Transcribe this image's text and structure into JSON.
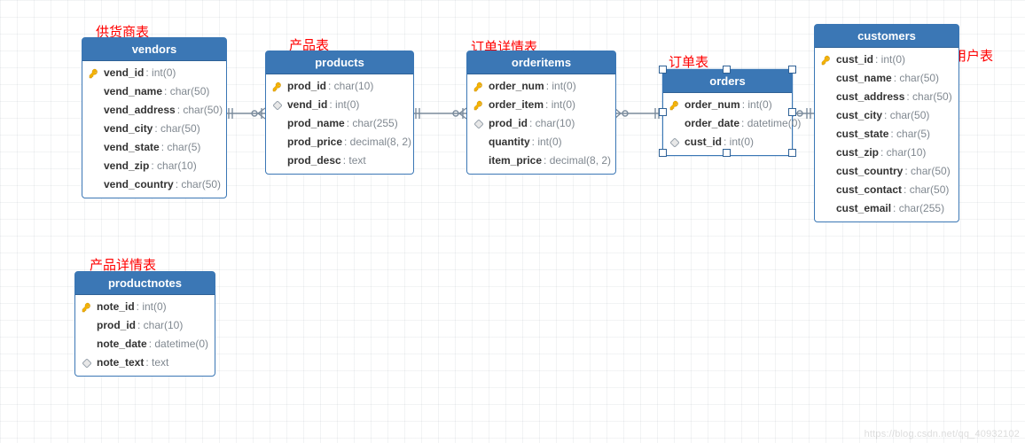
{
  "colors": {
    "header_bg": "#3b77b5",
    "border": "#3b77b5",
    "text_type": "#808890",
    "annotation": "#ff0000"
  },
  "tables": {
    "vendors": {
      "title": "vendors",
      "annotation": "供货商表",
      "columns": [
        {
          "name": "vend_id",
          "type": "int(0)",
          "key": "pk"
        },
        {
          "name": "vend_name",
          "type": "char(50)",
          "key": null
        },
        {
          "name": "vend_address",
          "type": "char(50)",
          "key": null
        },
        {
          "name": "vend_city",
          "type": "char(50)",
          "key": null
        },
        {
          "name": "vend_state",
          "type": "char(5)",
          "key": null
        },
        {
          "name": "vend_zip",
          "type": "char(10)",
          "key": null
        },
        {
          "name": "vend_country",
          "type": "char(50)",
          "key": null
        }
      ]
    },
    "products": {
      "title": "products",
      "annotation": "产品表",
      "columns": [
        {
          "name": "prod_id",
          "type": "char(10)",
          "key": "pk"
        },
        {
          "name": "vend_id",
          "type": "int(0)",
          "key": "fk"
        },
        {
          "name": "prod_name",
          "type": "char(255)",
          "key": null
        },
        {
          "name": "prod_price",
          "type": "decimal(8, 2)",
          "key": null
        },
        {
          "name": "prod_desc",
          "type": "text",
          "key": null
        }
      ]
    },
    "orderitems": {
      "title": "orderitems",
      "annotation": "订单详情表",
      "columns": [
        {
          "name": "order_num",
          "type": "int(0)",
          "key": "pk"
        },
        {
          "name": "order_item",
          "type": "int(0)",
          "key": "pk"
        },
        {
          "name": "prod_id",
          "type": "char(10)",
          "key": "fk"
        },
        {
          "name": "quantity",
          "type": "int(0)",
          "key": null
        },
        {
          "name": "item_price",
          "type": "decimal(8, 2)",
          "key": null
        }
      ]
    },
    "orders": {
      "title": "orders",
      "annotation": "订单表",
      "selected": true,
      "columns": [
        {
          "name": "order_num",
          "type": "int(0)",
          "key": "pk"
        },
        {
          "name": "order_date",
          "type": "datetime(0)",
          "key": null
        },
        {
          "name": "cust_id",
          "type": "int(0)",
          "key": "fk"
        }
      ]
    },
    "customers": {
      "title": "customers",
      "annotation": "用户表",
      "columns": [
        {
          "name": "cust_id",
          "type": "int(0)",
          "key": "pk"
        },
        {
          "name": "cust_name",
          "type": "char(50)",
          "key": null
        },
        {
          "name": "cust_address",
          "type": "char(50)",
          "key": null
        },
        {
          "name": "cust_city",
          "type": "char(50)",
          "key": null
        },
        {
          "name": "cust_state",
          "type": "char(5)",
          "key": null
        },
        {
          "name": "cust_zip",
          "type": "char(10)",
          "key": null
        },
        {
          "name": "cust_country",
          "type": "char(50)",
          "key": null
        },
        {
          "name": "cust_contact",
          "type": "char(50)",
          "key": null
        },
        {
          "name": "cust_email",
          "type": "char(255)",
          "key": null
        }
      ]
    },
    "productnotes": {
      "title": "productnotes",
      "annotation": "产品详情表",
      "columns": [
        {
          "name": "note_id",
          "type": "int(0)",
          "key": "pk"
        },
        {
          "name": "prod_id",
          "type": "char(10)",
          "key": null
        },
        {
          "name": "note_date",
          "type": "datetime(0)",
          "key": null
        },
        {
          "name": "note_text",
          "type": "text",
          "key": "fk"
        }
      ]
    }
  },
  "relationships": [
    {
      "from": "vendors.vend_id",
      "to": "products.vend_id",
      "type": "one-to-many"
    },
    {
      "from": "products.prod_id",
      "to": "orderitems.prod_id",
      "type": "one-to-many"
    },
    {
      "from": "orderitems.order_num",
      "to": "orders.order_num",
      "type": "many-to-one"
    },
    {
      "from": "orders.cust_id",
      "to": "customers.cust_id",
      "type": "many-to-one"
    }
  ],
  "watermark": "https://blog.csdn.net/qq_40932102"
}
